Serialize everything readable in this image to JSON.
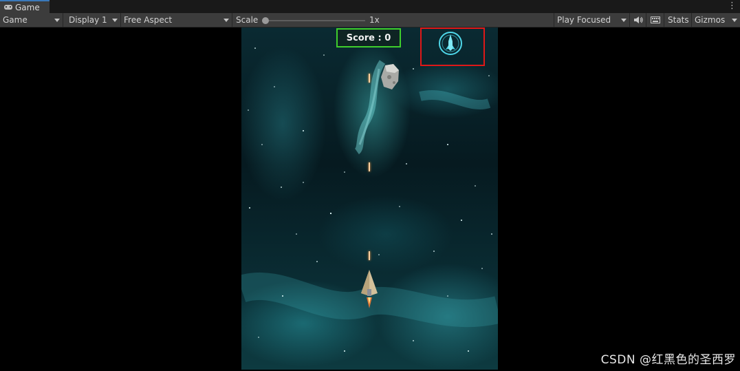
{
  "tab": {
    "label": "Game",
    "menu_glyph": "⋮"
  },
  "toolbar": {
    "view_select": "Game",
    "display_select": "Display 1",
    "aspect_select": "Free Aspect",
    "scale_label": "Scale",
    "scale_value": "1x",
    "play_mode_select": "Play Focused",
    "stats_label": "Stats",
    "gizmos_label": "Gizmos"
  },
  "hud": {
    "score_text": "Score : 0",
    "highlight_color": "#e01818",
    "score_border_color": "#3fcf2c"
  },
  "scene": {
    "player": "spaceship",
    "enemy": "asteroid",
    "bullet_count": 3,
    "ability_icon": "rocket-shield-icon"
  },
  "watermark": "CSDN @红黑色的圣西罗"
}
